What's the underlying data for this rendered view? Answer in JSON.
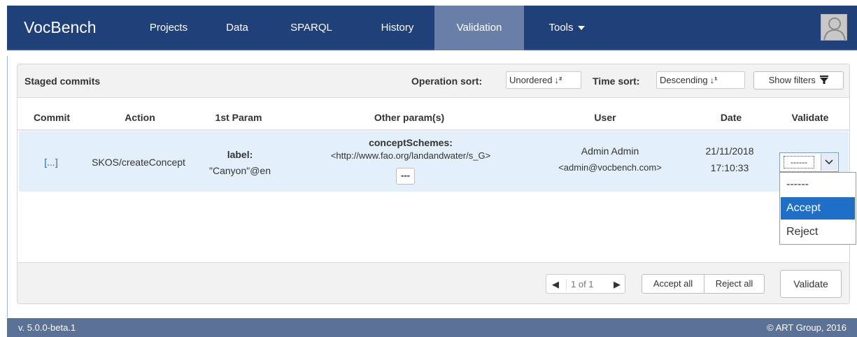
{
  "navbar": {
    "brand": "VocBench",
    "items": [
      {
        "label": "Projects"
      },
      {
        "label": "Data"
      },
      {
        "label": "SPARQL"
      },
      {
        "label": "History"
      },
      {
        "label": "Validation",
        "active": true
      },
      {
        "label": "Tools"
      }
    ]
  },
  "panel": {
    "title": "Staged commits",
    "operation_sort_label": "Operation sort:",
    "operation_sort_value": "Unordered",
    "time_sort_label": "Time sort:",
    "time_sort_value": "Descending",
    "show_filters_label": "Show filters"
  },
  "table": {
    "columns": [
      "Commit",
      "Action",
      "1st Param",
      "Other param(s)",
      "User",
      "Date",
      "Validate"
    ],
    "rows": [
      {
        "commit": "[...]",
        "action": "SKOS/createConcept",
        "param_name": "label:",
        "param_value": "\"Canyon\"@en",
        "other_name": "conceptSchemes:",
        "other_value": "<http://www.fao.org/landandwater/s_G>",
        "more_button": "---",
        "user_name": "Admin Admin",
        "user_email": "<admin@vocbench.com>",
        "date": "21/11/2018",
        "time": "17:10:33",
        "validate_selected": "------"
      }
    ]
  },
  "validate_dropdown": {
    "options": [
      "------",
      "Accept",
      "Reject"
    ],
    "highlighted": "Accept"
  },
  "footer": {
    "pager": "1 of 1",
    "accept_all": "Accept all",
    "reject_all": "Reject all",
    "validate": "Validate"
  },
  "statusbar": {
    "version": "v. 5.0.0-beta.1",
    "copyright": "© ART Group, 2016"
  },
  "colors": {
    "navbar": "#20407a",
    "active_tab": "#6a7fa8",
    "row_highlight": "#e3f0fb",
    "option_highlight": "#1f6fc7",
    "statusbar": "#5b7196"
  }
}
